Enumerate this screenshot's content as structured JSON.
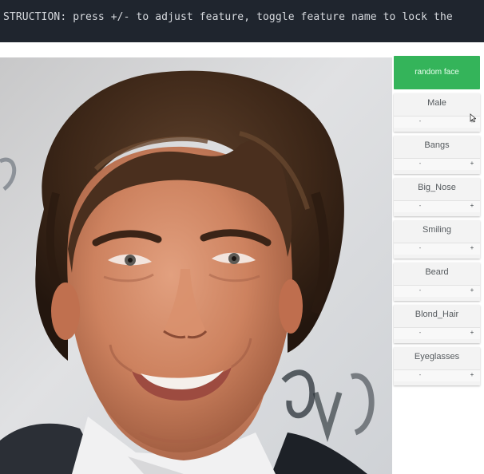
{
  "instruction": {
    "text": "STRUCTION: press +/- to adjust feature, toggle feature name to lock the"
  },
  "controls": {
    "random_button_label": "random face",
    "features": [
      {
        "name": "Male",
        "minus": "-",
        "plus": "+"
      },
      {
        "name": "Bangs",
        "minus": "-",
        "plus": "+"
      },
      {
        "name": "Big_Nose",
        "minus": "-",
        "plus": "+"
      },
      {
        "name": "Smiling",
        "minus": "-",
        "plus": "+"
      },
      {
        "name": "Beard",
        "minus": "-",
        "plus": "+"
      },
      {
        "name": "Blond_Hair",
        "minus": "-",
        "plus": "+"
      },
      {
        "name": "Eyeglasses",
        "minus": "-",
        "plus": "+"
      }
    ]
  },
  "colors": {
    "topbar_bg": "#1f252e",
    "accent_green": "#34b45a"
  },
  "icons": {
    "cursor": "mouse-pointer-icon"
  }
}
